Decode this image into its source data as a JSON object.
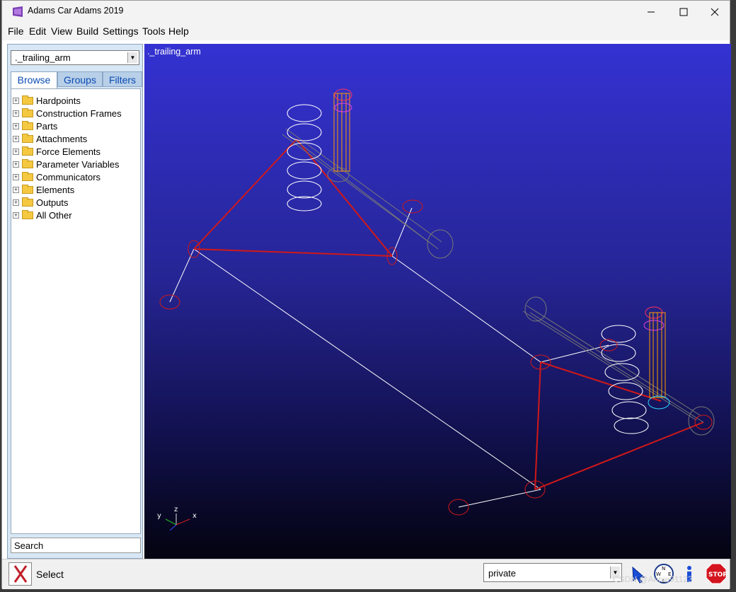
{
  "window": {
    "title": "Adams Car Adams 2019"
  },
  "menu": [
    "File",
    "Edit",
    "View",
    "Build",
    "Settings",
    "Tools",
    "Help"
  ],
  "left_panel": {
    "model_selector": "._trailing_arm",
    "tabs": [
      "Browse",
      "Groups",
      "Filters"
    ],
    "tree_items": [
      "Hardpoints",
      "Construction Frames",
      "Parts",
      "Attachments",
      "Force Elements",
      "Parameter Variables",
      "Communicators",
      "Elements",
      "Outputs",
      "All Other"
    ],
    "search_label": "Search"
  },
  "viewport": {
    "label": "._trailing_arm",
    "triad": {
      "y": "y",
      "z": "z",
      "x": "x"
    }
  },
  "status_bar": {
    "status": "Select",
    "database": "private",
    "stop_label": "STOP"
  },
  "watermark": "CSDN @Annie91123"
}
